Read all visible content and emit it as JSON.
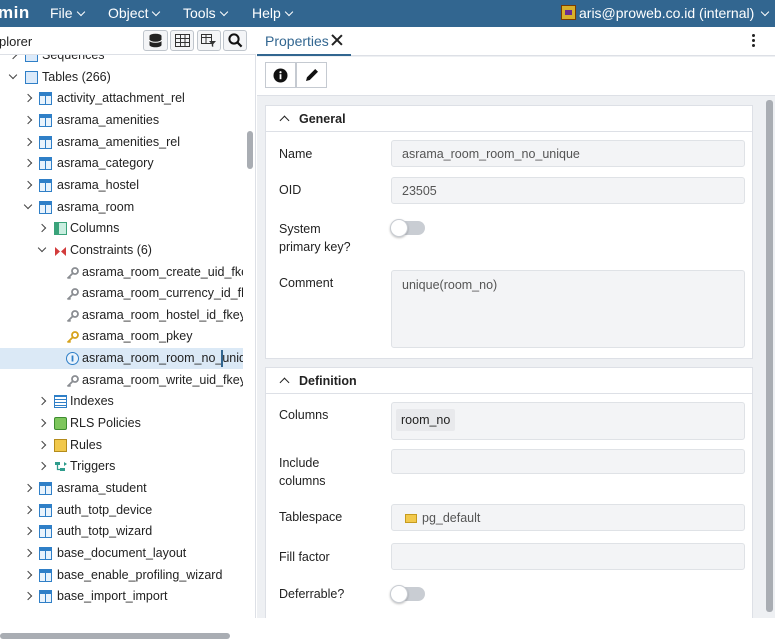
{
  "app": {
    "brand": "min"
  },
  "menu": [
    {
      "label": "File"
    },
    {
      "label": "Object"
    },
    {
      "label": "Tools"
    },
    {
      "label": "Help"
    }
  ],
  "user": {
    "label": "aris@proweb.co.id (internal)"
  },
  "explorer": {
    "title": "plorer"
  },
  "tree": [
    {
      "label": "Sequences",
      "indent": 1,
      "icon": "sequences-icon",
      "tog": "c"
    },
    {
      "label": "Tables (266)",
      "indent": 1,
      "icon": "tables-icon",
      "tog": "o"
    },
    {
      "label": "activity_attachment_rel",
      "indent": 2,
      "icon": "table-icon",
      "tog": "c"
    },
    {
      "label": "asrama_amenities",
      "indent": 2,
      "icon": "table-icon",
      "tog": "c"
    },
    {
      "label": "asrama_amenities_rel",
      "indent": 2,
      "icon": "table-icon",
      "tog": "c"
    },
    {
      "label": "asrama_category",
      "indent": 2,
      "icon": "table-icon",
      "tog": "c"
    },
    {
      "label": "asrama_hostel",
      "indent": 2,
      "icon": "table-icon",
      "tog": "c"
    },
    {
      "label": "asrama_room",
      "indent": 2,
      "icon": "table-icon",
      "tog": "o"
    },
    {
      "label": "Columns",
      "indent": 3,
      "icon": "columns-icon",
      "tog": "c"
    },
    {
      "label": "Constraints (6)",
      "indent": 3,
      "icon": "constraints-icon",
      "tog": "o"
    },
    {
      "label": "asrama_room_create_uid_fkey",
      "indent": 4,
      "icon": "foreign-key-icon",
      "tog": ""
    },
    {
      "label": "asrama_room_currency_id_fkey",
      "indent": 4,
      "icon": "foreign-key-icon",
      "tog": ""
    },
    {
      "label": "asrama_room_hostel_id_fkey",
      "indent": 4,
      "icon": "foreign-key-icon",
      "tog": ""
    },
    {
      "label": "asrama_room_pkey",
      "indent": 4,
      "icon": "primary-key-icon",
      "tog": ""
    },
    {
      "label": "asrama_room_room_no_unique",
      "indent": 4,
      "icon": "unique-constraint-icon",
      "tog": "",
      "selected": true
    },
    {
      "label": "asrama_room_write_uid_fkey",
      "indent": 4,
      "icon": "foreign-key-icon",
      "tog": ""
    },
    {
      "label": "Indexes",
      "indent": 3,
      "icon": "indexes-icon",
      "tog": "c"
    },
    {
      "label": "RLS Policies",
      "indent": 3,
      "icon": "rls-policies-icon",
      "tog": "c"
    },
    {
      "label": "Rules",
      "indent": 3,
      "icon": "rules-icon",
      "tog": "c"
    },
    {
      "label": "Triggers",
      "indent": 3,
      "icon": "triggers-icon",
      "tog": "c"
    },
    {
      "label": "asrama_student",
      "indent": 2,
      "icon": "table-icon",
      "tog": "c"
    },
    {
      "label": "auth_totp_device",
      "indent": 2,
      "icon": "table-icon",
      "tog": "c"
    },
    {
      "label": "auth_totp_wizard",
      "indent": 2,
      "icon": "table-icon",
      "tog": "c"
    },
    {
      "label": "base_document_layout",
      "indent": 2,
      "icon": "table-icon",
      "tog": "c"
    },
    {
      "label": "base_enable_profiling_wizard",
      "indent": 2,
      "icon": "table-icon",
      "tog": "c"
    },
    {
      "label": "base_import_import",
      "indent": 2,
      "icon": "table-icon",
      "tog": "c"
    }
  ],
  "tab": {
    "label": "Properties"
  },
  "general": {
    "title": "General",
    "name_label": "Name",
    "name_value": "asrama_room_room_no_unique",
    "oid_label": "OID",
    "oid_value": "23505",
    "sys_pk_label_1": "System",
    "sys_pk_label_2": "primary key?",
    "sys_pk_value": false,
    "comment_label": "Comment",
    "comment_value": "unique(room_no)"
  },
  "definition": {
    "title": "Definition",
    "columns_label": "Columns",
    "columns_value": "room_no",
    "include_label_1": "Include",
    "include_label_2": "columns",
    "tablespace_label": "Tablespace",
    "tablespace_value": "pg_default",
    "fill_factor_label": "Fill factor",
    "deferrable_label": "Deferrable?",
    "deferrable_value": false
  }
}
